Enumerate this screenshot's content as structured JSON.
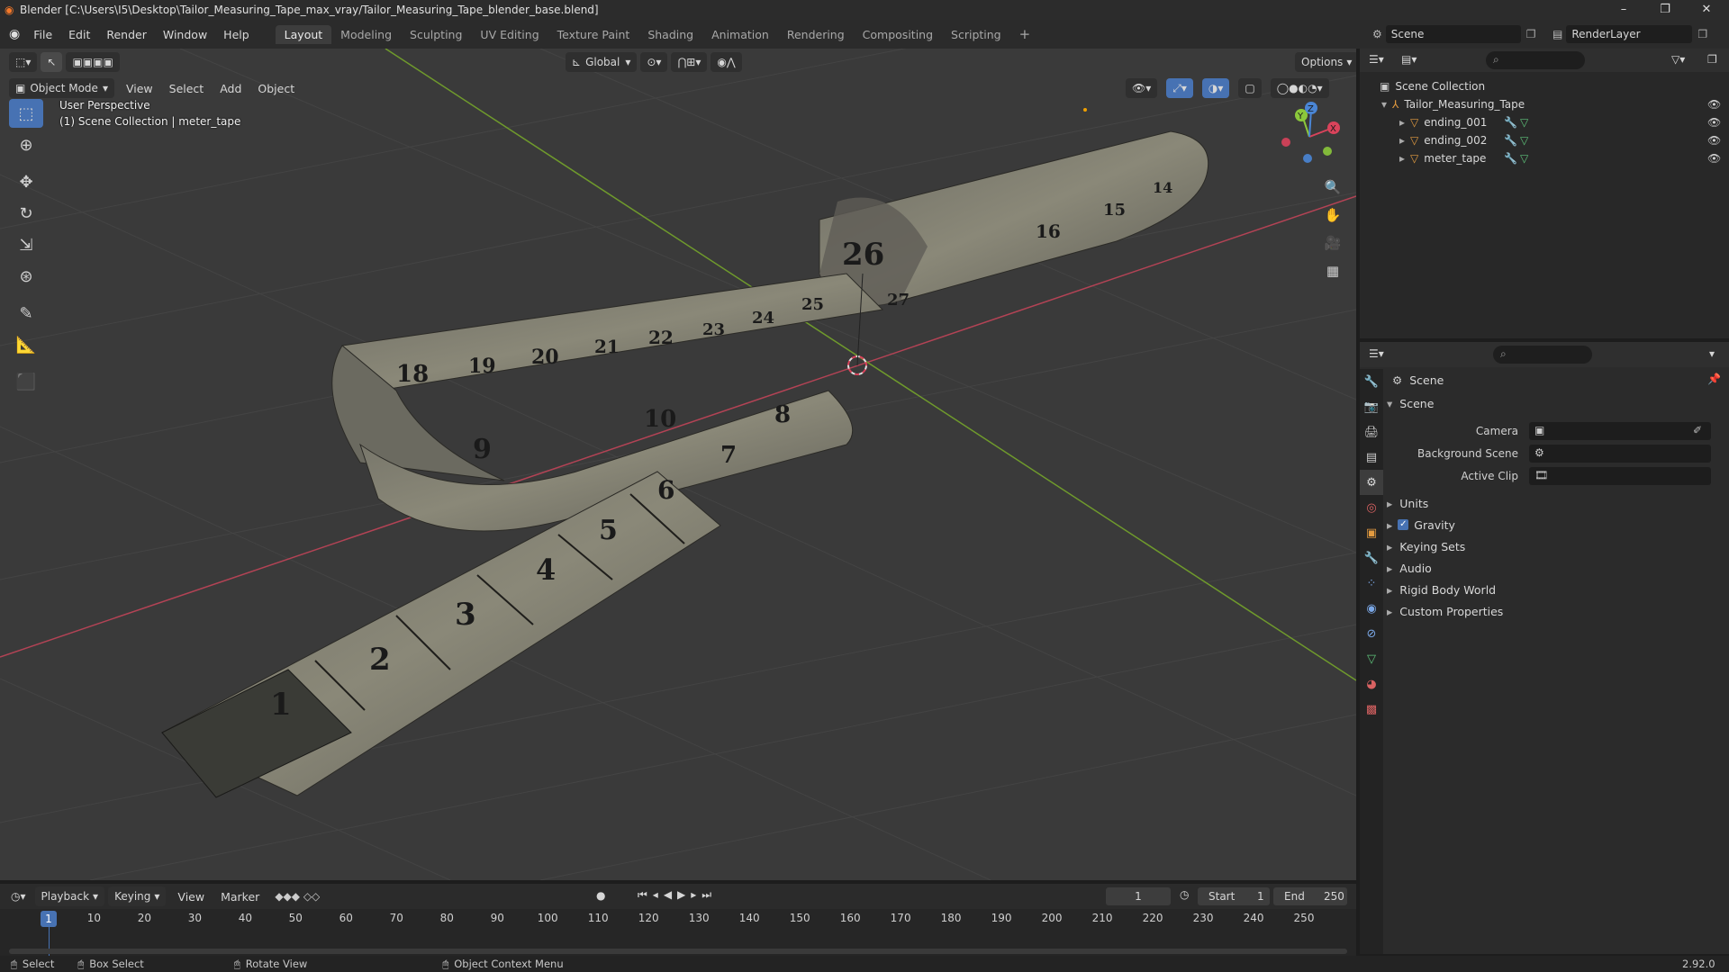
{
  "window": {
    "title": "Blender [C:\\Users\\I5\\Desktop\\Tailor_Measuring_Tape_max_vray/Tailor_Measuring_Tape_blender_base.blend]",
    "minimize": "–",
    "maximize": "❐",
    "close": "✕"
  },
  "menu": {
    "items": [
      "File",
      "Edit",
      "Render",
      "Window",
      "Help"
    ],
    "workspaces": [
      "Layout",
      "Modeling",
      "Sculpting",
      "UV Editing",
      "Texture Paint",
      "Shading",
      "Animation",
      "Rendering",
      "Compositing",
      "Scripting"
    ],
    "add_tab": "+",
    "scene_label": "Scene",
    "render_layer_label": "RenderLayer"
  },
  "viewport": {
    "transform_orientation": "Global",
    "options_label": "Options",
    "mode": "Object Mode",
    "menus": [
      "View",
      "Select",
      "Add",
      "Object"
    ],
    "perspective_label": "User Perspective",
    "collection_label": "(1) Scene Collection | meter_tape",
    "gizmo_axes": [
      "X",
      "Y",
      "Z"
    ]
  },
  "tape_numbers": [
    "1",
    "2",
    "3",
    "4",
    "5",
    "6",
    "7",
    "8",
    "9",
    "10",
    "18",
    "19",
    "20",
    "21",
    "22",
    "23",
    "24",
    "25",
    "26",
    "27",
    "16",
    "15",
    "14"
  ],
  "outliner": {
    "root": "Scene Collection",
    "collection": "Tailor_Measuring_Tape",
    "objects": [
      "ending_001",
      "ending_002",
      "meter_tape"
    ]
  },
  "properties": {
    "header": "Scene",
    "panel_title": "Scene",
    "fields": [
      {
        "label": "Camera",
        "value": ""
      },
      {
        "label": "Background Scene",
        "value": ""
      },
      {
        "label": "Active Clip",
        "value": ""
      }
    ],
    "subpanels": [
      "Units",
      "Gravity",
      "Keying Sets",
      "Audio",
      "Rigid Body World",
      "Custom Properties"
    ],
    "gravity_checked": true
  },
  "timeline": {
    "menus": [
      "Playback",
      "Keying",
      "View",
      "Marker"
    ],
    "current_frame": "1",
    "start_label": "Start",
    "start_value": "1",
    "end_label": "End",
    "end_value": "250",
    "frame_ticks": [
      "1",
      "10",
      "20",
      "30",
      "40",
      "50",
      "60",
      "70",
      "80",
      "90",
      "100",
      "110",
      "120",
      "130",
      "140",
      "150",
      "160",
      "170",
      "180",
      "190",
      "200",
      "210",
      "220",
      "230",
      "240",
      "250"
    ]
  },
  "statusbar": {
    "select": "Select",
    "box_select": "Box Select",
    "rotate_view": "Rotate View",
    "context_menu": "Object Context Menu",
    "version": "2.92.0"
  },
  "colors": {
    "accent": "#4772b3",
    "x_axis": "#d9435b",
    "y_axis": "#8bc83b",
    "z_axis": "#4a86d6",
    "viewport_bg": "#3a3a3a"
  }
}
